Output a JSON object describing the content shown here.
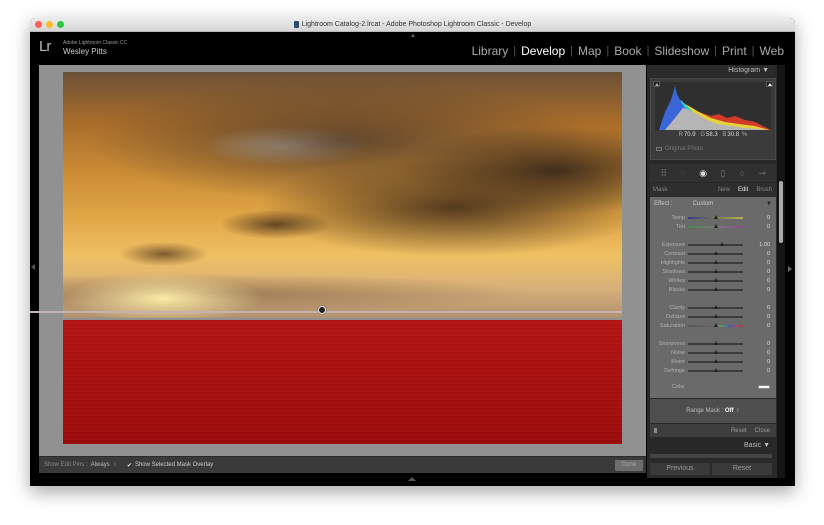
{
  "window": {
    "title": "Lightroom Catalog-2.lrcat - Adobe Photoshop Lightroom Classic - Develop"
  },
  "identity": {
    "logo": "Lr",
    "product": "Adobe Lightroom Classic CC",
    "user": "Wesley Pitts"
  },
  "modules": [
    {
      "label": "Library",
      "active": false
    },
    {
      "label": "Develop",
      "active": true
    },
    {
      "label": "Map",
      "active": false
    },
    {
      "label": "Book",
      "active": false
    },
    {
      "label": "Slideshow",
      "active": false
    },
    {
      "label": "Print",
      "active": false
    },
    {
      "label": "Web",
      "active": false
    }
  ],
  "histogram": {
    "title": "Histogram",
    "r_label": "R",
    "r_value": "70.9",
    "g_label": "G",
    "g_value": "58.3",
    "b_label": "B",
    "b_value": "30.8",
    "unit": "%",
    "original_photo": "Original Photo"
  },
  "mask_row": {
    "label": "Mask :",
    "options": [
      "New",
      "Edit",
      "Brush"
    ],
    "active": "Edit"
  },
  "effect": {
    "label": "Effect :",
    "value": "Custom"
  },
  "sliders": [
    {
      "name": "Temp",
      "value": "0",
      "position": 0.5,
      "track": "temp"
    },
    {
      "name": "Tint",
      "value": "0",
      "position": 0.5,
      "track": "tint"
    },
    {
      "name": "Exposure",
      "value": "1.00",
      "position": 0.62,
      "track": "plain"
    },
    {
      "name": "Contrast",
      "value": "0",
      "position": 0.5,
      "track": "plain"
    },
    {
      "name": "Highlights",
      "value": "0",
      "position": 0.5,
      "track": "plain"
    },
    {
      "name": "Shadows",
      "value": "0",
      "position": 0.5,
      "track": "plain"
    },
    {
      "name": "Whites",
      "value": "0",
      "position": 0.5,
      "track": "plain"
    },
    {
      "name": "Blacks",
      "value": "0",
      "position": 0.5,
      "track": "plain"
    },
    {
      "name": "Clarity",
      "value": "0",
      "position": 0.5,
      "track": "plain"
    },
    {
      "name": "Dehaze",
      "value": "0",
      "position": 0.5,
      "track": "plain"
    },
    {
      "name": "Saturation",
      "value": "0",
      "position": 0.5,
      "track": "sat"
    },
    {
      "name": "Sharpness",
      "value": "0",
      "position": 0.5,
      "track": "plain"
    },
    {
      "name": "Noise",
      "value": "0",
      "position": 0.5,
      "track": "plain"
    },
    {
      "name": "Moire",
      "value": "0",
      "position": 0.5,
      "track": "plain"
    },
    {
      "name": "Defringe",
      "value": "0",
      "position": 0.5,
      "track": "plain"
    }
  ],
  "color_label": "Color",
  "range_mask": {
    "label": "Range Mask :",
    "value": "Off"
  },
  "reset_row": {
    "reset": "Reset",
    "close": "Close"
  },
  "basic_panel": "Basic",
  "buttons": {
    "previous": "Previous",
    "reset": "Reset",
    "done": "Done"
  },
  "bottom_toolbar": {
    "edit_pins_label": "Show Edit Pins :",
    "edit_pins_value": "Always",
    "overlay_checked": true,
    "overlay_label": "Show Selected Mask Overlay"
  },
  "colors": {
    "mask_overlay": "#b51515",
    "panel_bg": "#6a6a6a",
    "canvas_bg": "#919191"
  }
}
